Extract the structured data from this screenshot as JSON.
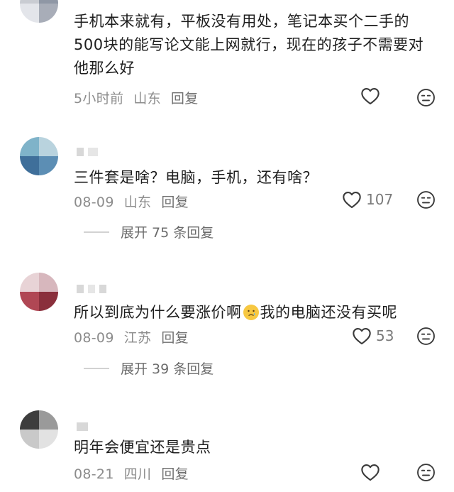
{
  "comments": [
    {
      "text": "手机本来就有，平板没有用处，笔记本买个二手的500块的能写论文能上网就行，现在的孩子不需要对他那么好",
      "time": "5小时前",
      "location": "山东",
      "reply": "回复",
      "likes": ""
    },
    {
      "text": "三件套是啥？电脑，手机，还有啥？",
      "time": "08-09",
      "location": "山东",
      "reply": "回复",
      "likes": "107",
      "expand": "展开 75 条回复"
    },
    {
      "text_before": "所以到底为什么要涨价啊",
      "text_after": "我的电脑还没有买呢",
      "time": "08-09",
      "location": "江苏",
      "reply": "回复",
      "likes": "53",
      "expand": "展开 39 条回复"
    },
    {
      "text": "明年会便宜还是贵点",
      "time": "08-21",
      "location": "四川",
      "reply": "回复",
      "likes": ""
    }
  ],
  "icons": {
    "like": "heart-outline-icon",
    "dislike": "meh-face-icon",
    "emoji": "crying-face-emoji"
  },
  "colors": {
    "text": "#1e1e1e",
    "meta": "#8c8c8c",
    "icon": "#3a3a3a"
  }
}
